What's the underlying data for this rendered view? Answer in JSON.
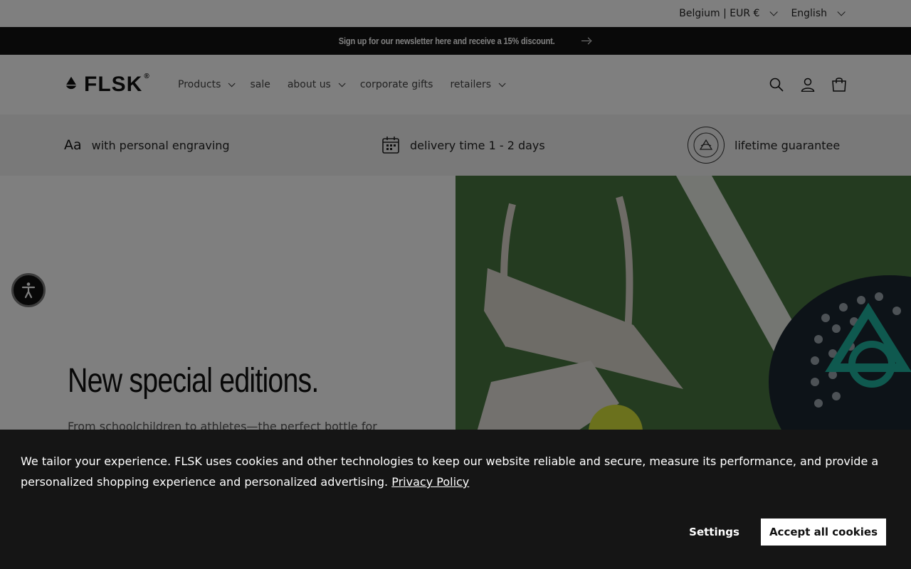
{
  "topbar": {
    "region_selector": "Belgium | EUR €",
    "language_selector": "English"
  },
  "announcement": {
    "text": "Sign up for our newsletter here and receive a 15% discount."
  },
  "header": {
    "logo_text": "FLSK",
    "logo_registered": "®",
    "nav": [
      {
        "label": "Products",
        "has_dropdown": true
      },
      {
        "label": "sale",
        "has_dropdown": false
      },
      {
        "label": "about us",
        "has_dropdown": true
      },
      {
        "label": "corporate gifts",
        "has_dropdown": false
      },
      {
        "label": "retailers",
        "has_dropdown": true
      }
    ],
    "icons": [
      "search-icon",
      "account-icon",
      "cart-icon"
    ]
  },
  "features": [
    {
      "icon_text": "Aa",
      "icon": "engraving-icon",
      "label": "with personal engraving"
    },
    {
      "icon": "calendar-icon",
      "label": "delivery time 1 - 2 days"
    },
    {
      "icon": "guarantee-seal-icon",
      "label": "lifetime guarantee"
    }
  ],
  "hero": {
    "title": "New special editions.",
    "subtitle": "From schoolchildren to athletes—the perfect bottle for"
  },
  "cookie_banner": {
    "text": "We tailor your experience. FLSK uses cookies and other technologies to keep our website reliable and secure, measure its performance, and provide a personalized shopping experience and personalized advertising.",
    "link_label": "Privacy Policy",
    "settings_label": "Settings",
    "accept_label": "Accept all cookies"
  },
  "colors": {
    "accent": "#121212",
    "overlay": "rgba(0,0,0,0.5)",
    "banner_bg": "#151515"
  }
}
